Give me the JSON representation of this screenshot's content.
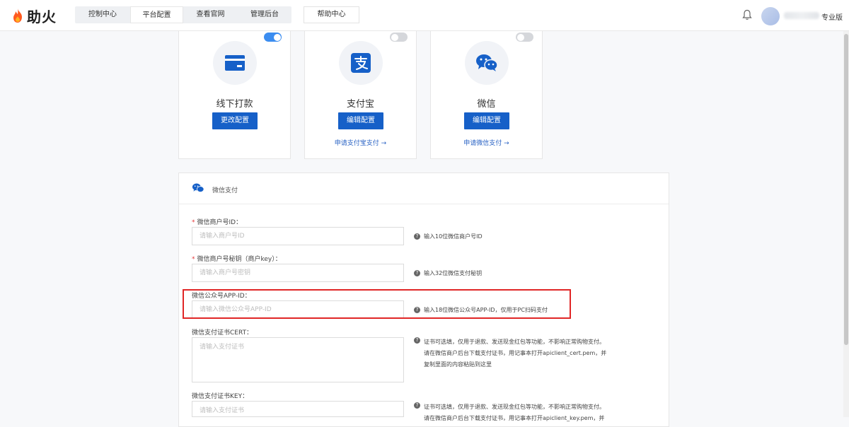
{
  "header": {
    "logo_text": "助火",
    "nav": [
      {
        "label": "控制中心",
        "active": false
      },
      {
        "label": "平台配置",
        "active": true
      },
      {
        "label": "查看官网",
        "active": false
      },
      {
        "label": "管理后台",
        "active": false
      }
    ],
    "help_label": "帮助中心",
    "edition": "专业版"
  },
  "payment_methods": [
    {
      "title": "线下打款",
      "enabled": true,
      "button": "更改配置",
      "link": "",
      "icon": "card-icon"
    },
    {
      "title": "支付宝",
      "enabled": false,
      "button": "编辑配置",
      "link": "申请支付宝支付 →",
      "icon": "alipay-icon"
    },
    {
      "title": "微信",
      "enabled": false,
      "button": "编辑配置",
      "link": "申请微信支付 →",
      "icon": "wechat-icon"
    }
  ],
  "wechat_pay": {
    "title": "微信支付",
    "fields": [
      {
        "label": "微信商户号ID：",
        "required": true,
        "placeholder": "请输入商户号ID",
        "hint": [
          "输入10位微信商户号ID"
        ]
      },
      {
        "label": "微信商户号秘钥（商户key）：",
        "required": true,
        "placeholder": "请输入商户号密钥",
        "hint": [
          "输入32位微信支付秘钥"
        ]
      },
      {
        "label": "微信公众号APP-ID：",
        "required": false,
        "placeholder": "请输入微信公众号APP-ID",
        "hint": [
          "输入18位微信公众号APP-ID，仅用于PC扫码支付"
        ]
      },
      {
        "label": "微信支付证书CERT：",
        "required": false,
        "placeholder": "请输入支付证书",
        "hint": [
          "证书可选填，仅用于退款、发送现金红包等功能，不影响正常购物支付。",
          "请在微信商户后台下载支付证书，用记事本打开apiclient_cert.pem，并",
          "复制里面的内容粘贴到这里"
        ]
      },
      {
        "label": "微信支付证书KEY：",
        "required": false,
        "placeholder": "请输入支付证书",
        "hint": [
          "证书可选填，仅用于退款、发送现金红包等功能，不影响正常购物支付。",
          "请在微信商户后台下载支付证书，用记事本打开apiclient_key.pem，并"
        ]
      }
    ]
  },
  "colors": {
    "accent": "#1660c8",
    "toggle_on": "#3b8df0",
    "highlight": "#e02626",
    "link": "#2a63c4"
  }
}
